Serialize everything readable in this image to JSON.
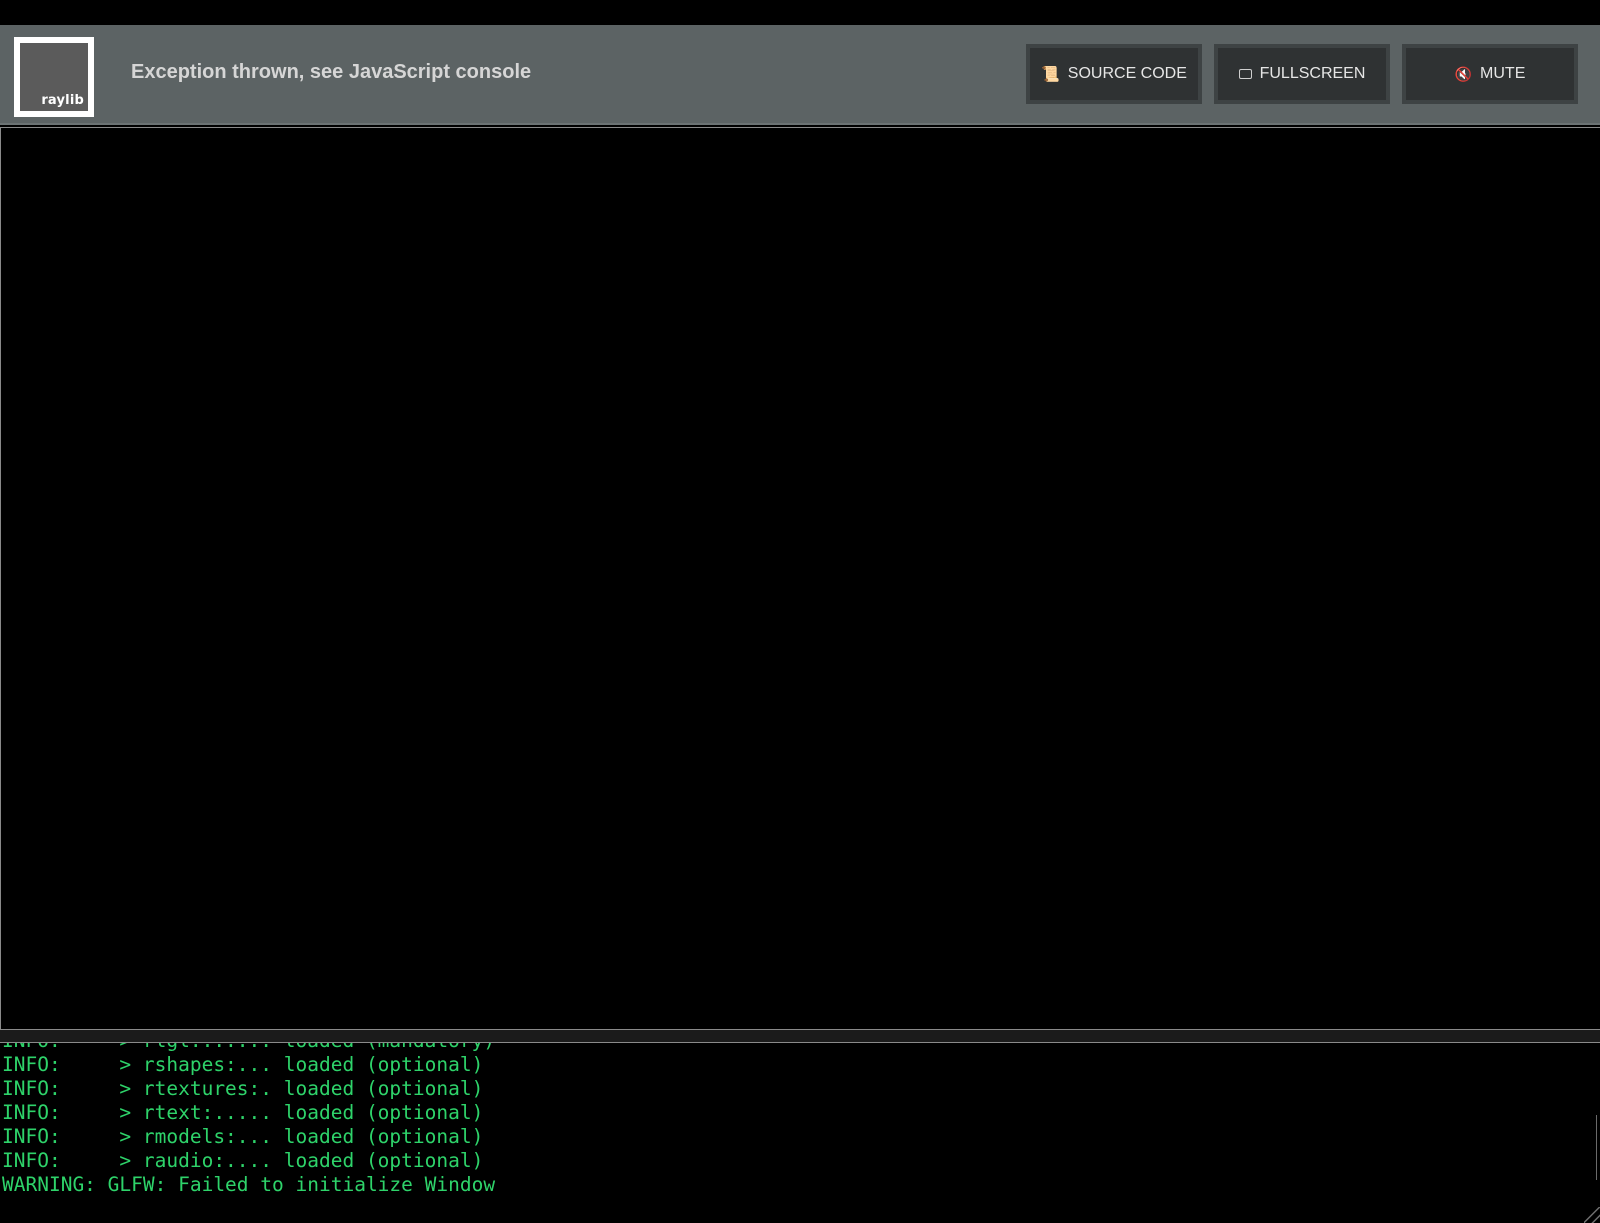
{
  "header": {
    "logo_text": "raylib",
    "status": "Exception thrown, see JavaScript console"
  },
  "toolbar": {
    "buttons": [
      {
        "label": "SOURCE CODE",
        "icon": "scroll-icon"
      },
      {
        "label": "FULLSCREEN",
        "icon": "fullscreen-icon"
      },
      {
        "label": "MUTE",
        "icon": "mute-icon"
      }
    ]
  },
  "console": {
    "lines": [
      "INFO:     > rlgl:...... loaded (mandatory)",
      "INFO:     > rshapes:... loaded (optional)",
      "INFO:     > rtextures:. loaded (optional)",
      "INFO:     > rtext:..... loaded (optional)",
      "INFO:     > rmodels:... loaded (optional)",
      "INFO:     > raudio:.... loaded (optional)",
      "WARNING: GLFW: Failed to initialize Window"
    ]
  },
  "colors": {
    "header_bg": "#5c6364",
    "console_text": "#2ed36a"
  }
}
